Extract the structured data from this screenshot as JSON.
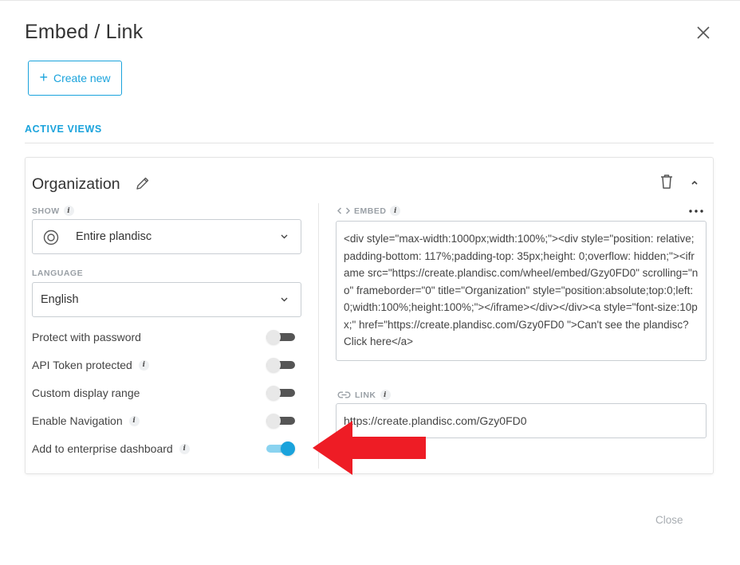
{
  "dialog": {
    "title": "Embed / Link",
    "create_new_label": "Create new",
    "section_heading": "ACTIVE VIEWS",
    "close_label": "Close"
  },
  "view": {
    "title": "Organization",
    "show": {
      "label": "SHOW",
      "selected": "Entire plandisc"
    },
    "language": {
      "label": "LANGUAGE",
      "selected": "English"
    },
    "toggles": [
      {
        "label": "Protect with password",
        "has_info": false,
        "on": false
      },
      {
        "label": "API Token protected",
        "has_info": true,
        "on": false
      },
      {
        "label": "Custom display range",
        "has_info": false,
        "on": false
      },
      {
        "label": "Enable Navigation",
        "has_info": true,
        "on": false
      },
      {
        "label": "Add to enterprise dashboard",
        "has_info": true,
        "on": true
      }
    ],
    "embed": {
      "label": "EMBED",
      "code": "<div style=\"max-width:1000px;width:100%;\"><div style=\"position: relative;padding-bottom: 117%;padding-top: 35px;height: 0;overflow: hidden;\"><iframe src=\"https://create.plandisc.com/wheel/embed/Gzy0FD0\" scrolling=\"no\" frameborder=\"0\" title=\"Organization\" style=\"position:absolute;top:0;left:0;width:100%;height:100%;\"></iframe></div></div><a style=\"font-size:10px;\" href=\"https://create.plandisc.com/Gzy0FD0 \">Can't see the plandisc? Click here</a>"
    },
    "link": {
      "label": "LINK",
      "url": "https://create.plandisc.com/Gzy0FD0"
    }
  },
  "colors": {
    "accent": "#1aa3dc",
    "arrow": "#ee1c25",
    "toggle_off_track": "#555555",
    "toggle_on_track": "#8ad3f0"
  },
  "icons": [
    "close-icon",
    "plus-icon",
    "pencil-icon",
    "trash-icon",
    "chevron-up-icon",
    "target-icon",
    "chevron-down-icon",
    "code-icon",
    "link-icon",
    "info-icon",
    "more-dots-icon",
    "red-arrow"
  ]
}
